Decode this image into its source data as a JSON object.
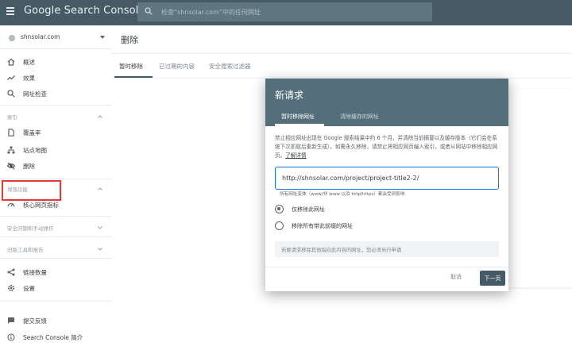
{
  "header": {
    "app_title": "Google Search Console",
    "search_placeholder": "检查“shnsolar.com”中的任何网址",
    "menu_icon": "menu-icon",
    "search_icon": "search-icon",
    "bar_color": "#455a64"
  },
  "sidebar": {
    "property": "shnsolar.com",
    "items_top": [
      {
        "label": "概述",
        "icon": "home-icon"
      },
      {
        "label": "效果",
        "icon": "trending-icon"
      },
      {
        "label": "网址检查",
        "icon": "search-icon"
      }
    ],
    "section_index": "索引",
    "items_index": [
      {
        "label": "覆盖率",
        "icon": "file-icon"
      },
      {
        "label": "站点地图",
        "icon": "sitemap-icon"
      },
      {
        "label": "删除",
        "icon": "eye-off-icon"
      }
    ],
    "section_experience": "增强功能",
    "items_experience": [
      {
        "label": "核心网页指标",
        "icon": "speed-icon"
      }
    ],
    "section_security": "安全问题和手动操作",
    "section_legacy": "旧版工具和报告",
    "items_bottom": [
      {
        "label": "链接数量",
        "icon": "links-icon"
      },
      {
        "label": "设置",
        "icon": "gear-icon"
      }
    ],
    "items_footer": [
      {
        "label": "提交反馈",
        "icon": "feedback-icon"
      },
      {
        "label": "Search Console 简介",
        "icon": "info-icon"
      }
    ],
    "highlight_color": "#e53935"
  },
  "main": {
    "page_title": "删除",
    "tabs": [
      {
        "label": "暂时移除",
        "active": true
      },
      {
        "label": "已过期的内容",
        "active": false
      },
      {
        "label": "安全搜索过滤器",
        "active": false
      }
    ]
  },
  "dialog": {
    "title": "新请求",
    "tabs": [
      {
        "label": "暂时移除网址",
        "active": true
      },
      {
        "label": "清除缓存的网址",
        "active": false
      }
    ],
    "description": "禁止相应网址出现在 Google 搜索结果中约 6 个月，并清除当前摘要以及缓存版本（它们会在系统下次抓取后重新生成）。如需永久移除，请禁止将相应网页编入索引，或者从网站中移除相应网页。",
    "learn_more": "了解详情",
    "url_value": "http://shnsolar.com/project/project-title2-2/",
    "helper_text": "所有网址变体（www/非 www 以及 http/https）都会受到影响",
    "options": [
      {
        "label": "仅移除此网址",
        "selected": true
      },
      {
        "label": "移除所有带此前缀的网址",
        "selected": false
      }
    ],
    "note": "若要请求移除其他指向此内容的网址，您必须另行申请",
    "cancel_label": "取消",
    "next_label": "下一页",
    "header_color": "#546e7a"
  }
}
